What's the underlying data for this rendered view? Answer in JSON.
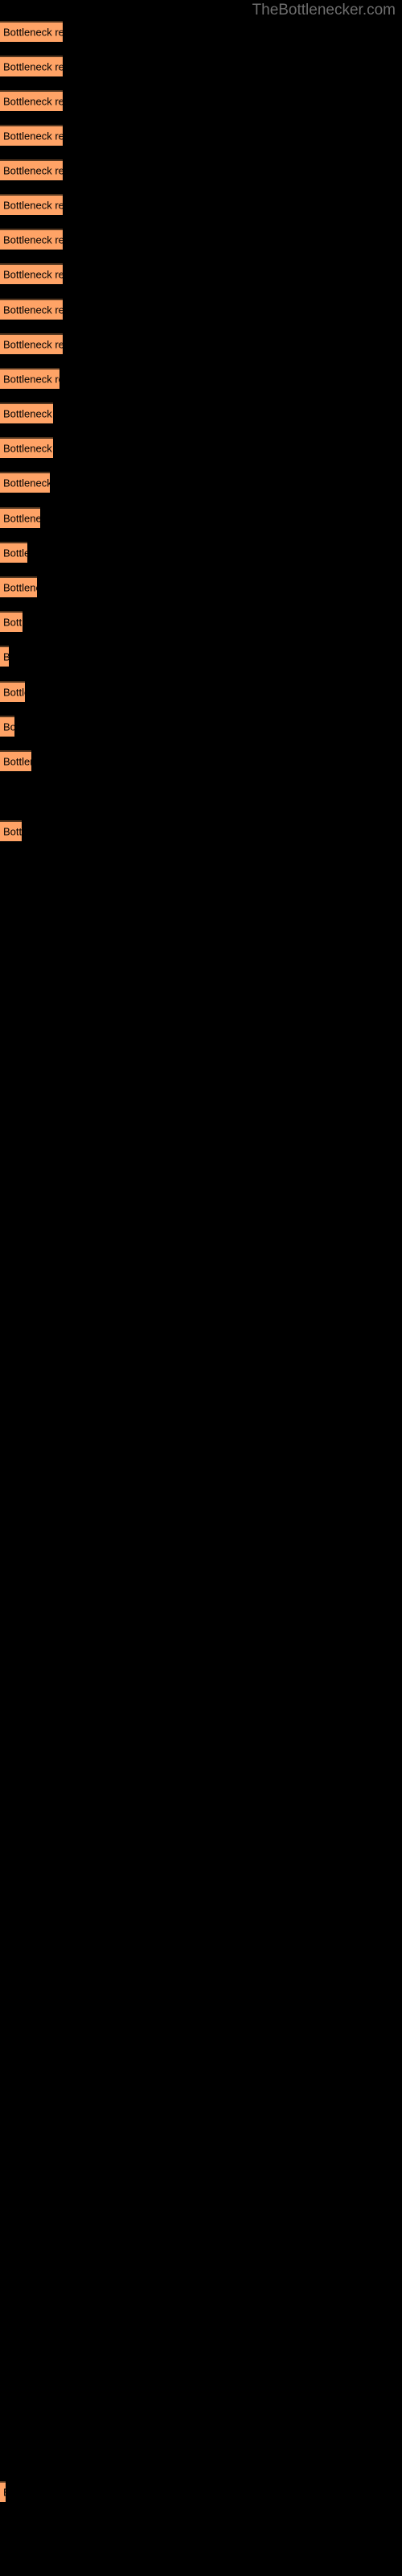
{
  "watermark": "TheBottlenecker.com",
  "colors": {
    "background": "#000000",
    "bar_fill": "#ffa366",
    "bar_border_top": "#53361f",
    "label_text": "#000000",
    "watermark_text": "#6e6e6e"
  },
  "chart_data": {
    "type": "bar",
    "orientation": "horizontal",
    "title": "",
    "xlabel": "",
    "ylabel": "",
    "grid": false,
    "legend": null,
    "categories": [
      "Bottleneck result",
      "Bottleneck result",
      "Bottleneck result",
      "Bottleneck result",
      "Bottleneck result",
      "Bottleneck result",
      "Bottleneck result",
      "Bottleneck result",
      "Bottleneck result",
      "Bottleneck result",
      "Bottleneck result",
      "Bottleneck result",
      "Bottleneck result",
      "Bottleneck result",
      "Bottleneck result",
      "Bottleneck result",
      "Bottleneck result",
      "Bottleneck result",
      "Bottleneck result",
      "Bottleneck result",
      "Bottleneck result",
      "Bottleneck result",
      "Bottleneck result",
      "Bottleneck result"
    ],
    "values": [
      78,
      78,
      78,
      78,
      78,
      78,
      78,
      78,
      78,
      78,
      74,
      66,
      66,
      62,
      50,
      34,
      46,
      28,
      11,
      31,
      18,
      39,
      27,
      7
    ],
    "xlim": [
      0,
      500
    ]
  },
  "bars": [
    {
      "label": "Bottleneck result",
      "y": 26,
      "h": 26,
      "w": 78
    },
    {
      "label": "Bottleneck result",
      "y": 69,
      "h": 26,
      "w": 78
    },
    {
      "label": "Bottleneck result",
      "y": 112,
      "h": 26,
      "w": 78
    },
    {
      "label": "Bottleneck result",
      "y": 155,
      "h": 26,
      "w": 78
    },
    {
      "label": "Bottleneck result",
      "y": 198,
      "h": 26,
      "w": 78
    },
    {
      "label": "Bottleneck result",
      "y": 241,
      "h": 26,
      "w": 78
    },
    {
      "label": "Bottleneck result",
      "y": 284,
      "h": 26,
      "w": 78
    },
    {
      "label": "Bottleneck result",
      "y": 327,
      "h": 26,
      "w": 78
    },
    {
      "label": "Bottleneck result",
      "y": 371,
      "h": 26,
      "w": 78
    },
    {
      "label": "Bottleneck result",
      "y": 414,
      "h": 26,
      "w": 78
    },
    {
      "label": "Bottleneck result",
      "y": 457,
      "h": 26,
      "w": 74
    },
    {
      "label": "Bottleneck result",
      "y": 500,
      "h": 26,
      "w": 66
    },
    {
      "label": "Bottleneck result",
      "y": 543,
      "h": 26,
      "w": 66
    },
    {
      "label": "Bottleneck result",
      "y": 586,
      "h": 26,
      "w": 62
    },
    {
      "label": "Bottleneck result",
      "y": 630,
      "h": 26,
      "w": 50
    },
    {
      "label": "Bottleneck result",
      "y": 673,
      "h": 26,
      "w": 34
    },
    {
      "label": "Bottleneck result",
      "y": 716,
      "h": 26,
      "w": 46
    },
    {
      "label": "Bottleneck result",
      "y": 759,
      "h": 26,
      "w": 28
    },
    {
      "label": "Bottleneck result",
      "y": 802,
      "h": 26,
      "w": 11
    },
    {
      "label": "Bottleneck result",
      "y": 846,
      "h": 26,
      "w": 31
    },
    {
      "label": "Bottleneck result",
      "y": 889,
      "h": 26,
      "w": 18
    },
    {
      "label": "Bottleneck result",
      "y": 932,
      "h": 26,
      "w": 39
    },
    {
      "label": "Bottleneck result",
      "y": 1019,
      "h": 26,
      "w": 27
    },
    {
      "label": "Bottleneck result",
      "y": 3082,
      "h": 26,
      "w": 7
    }
  ]
}
